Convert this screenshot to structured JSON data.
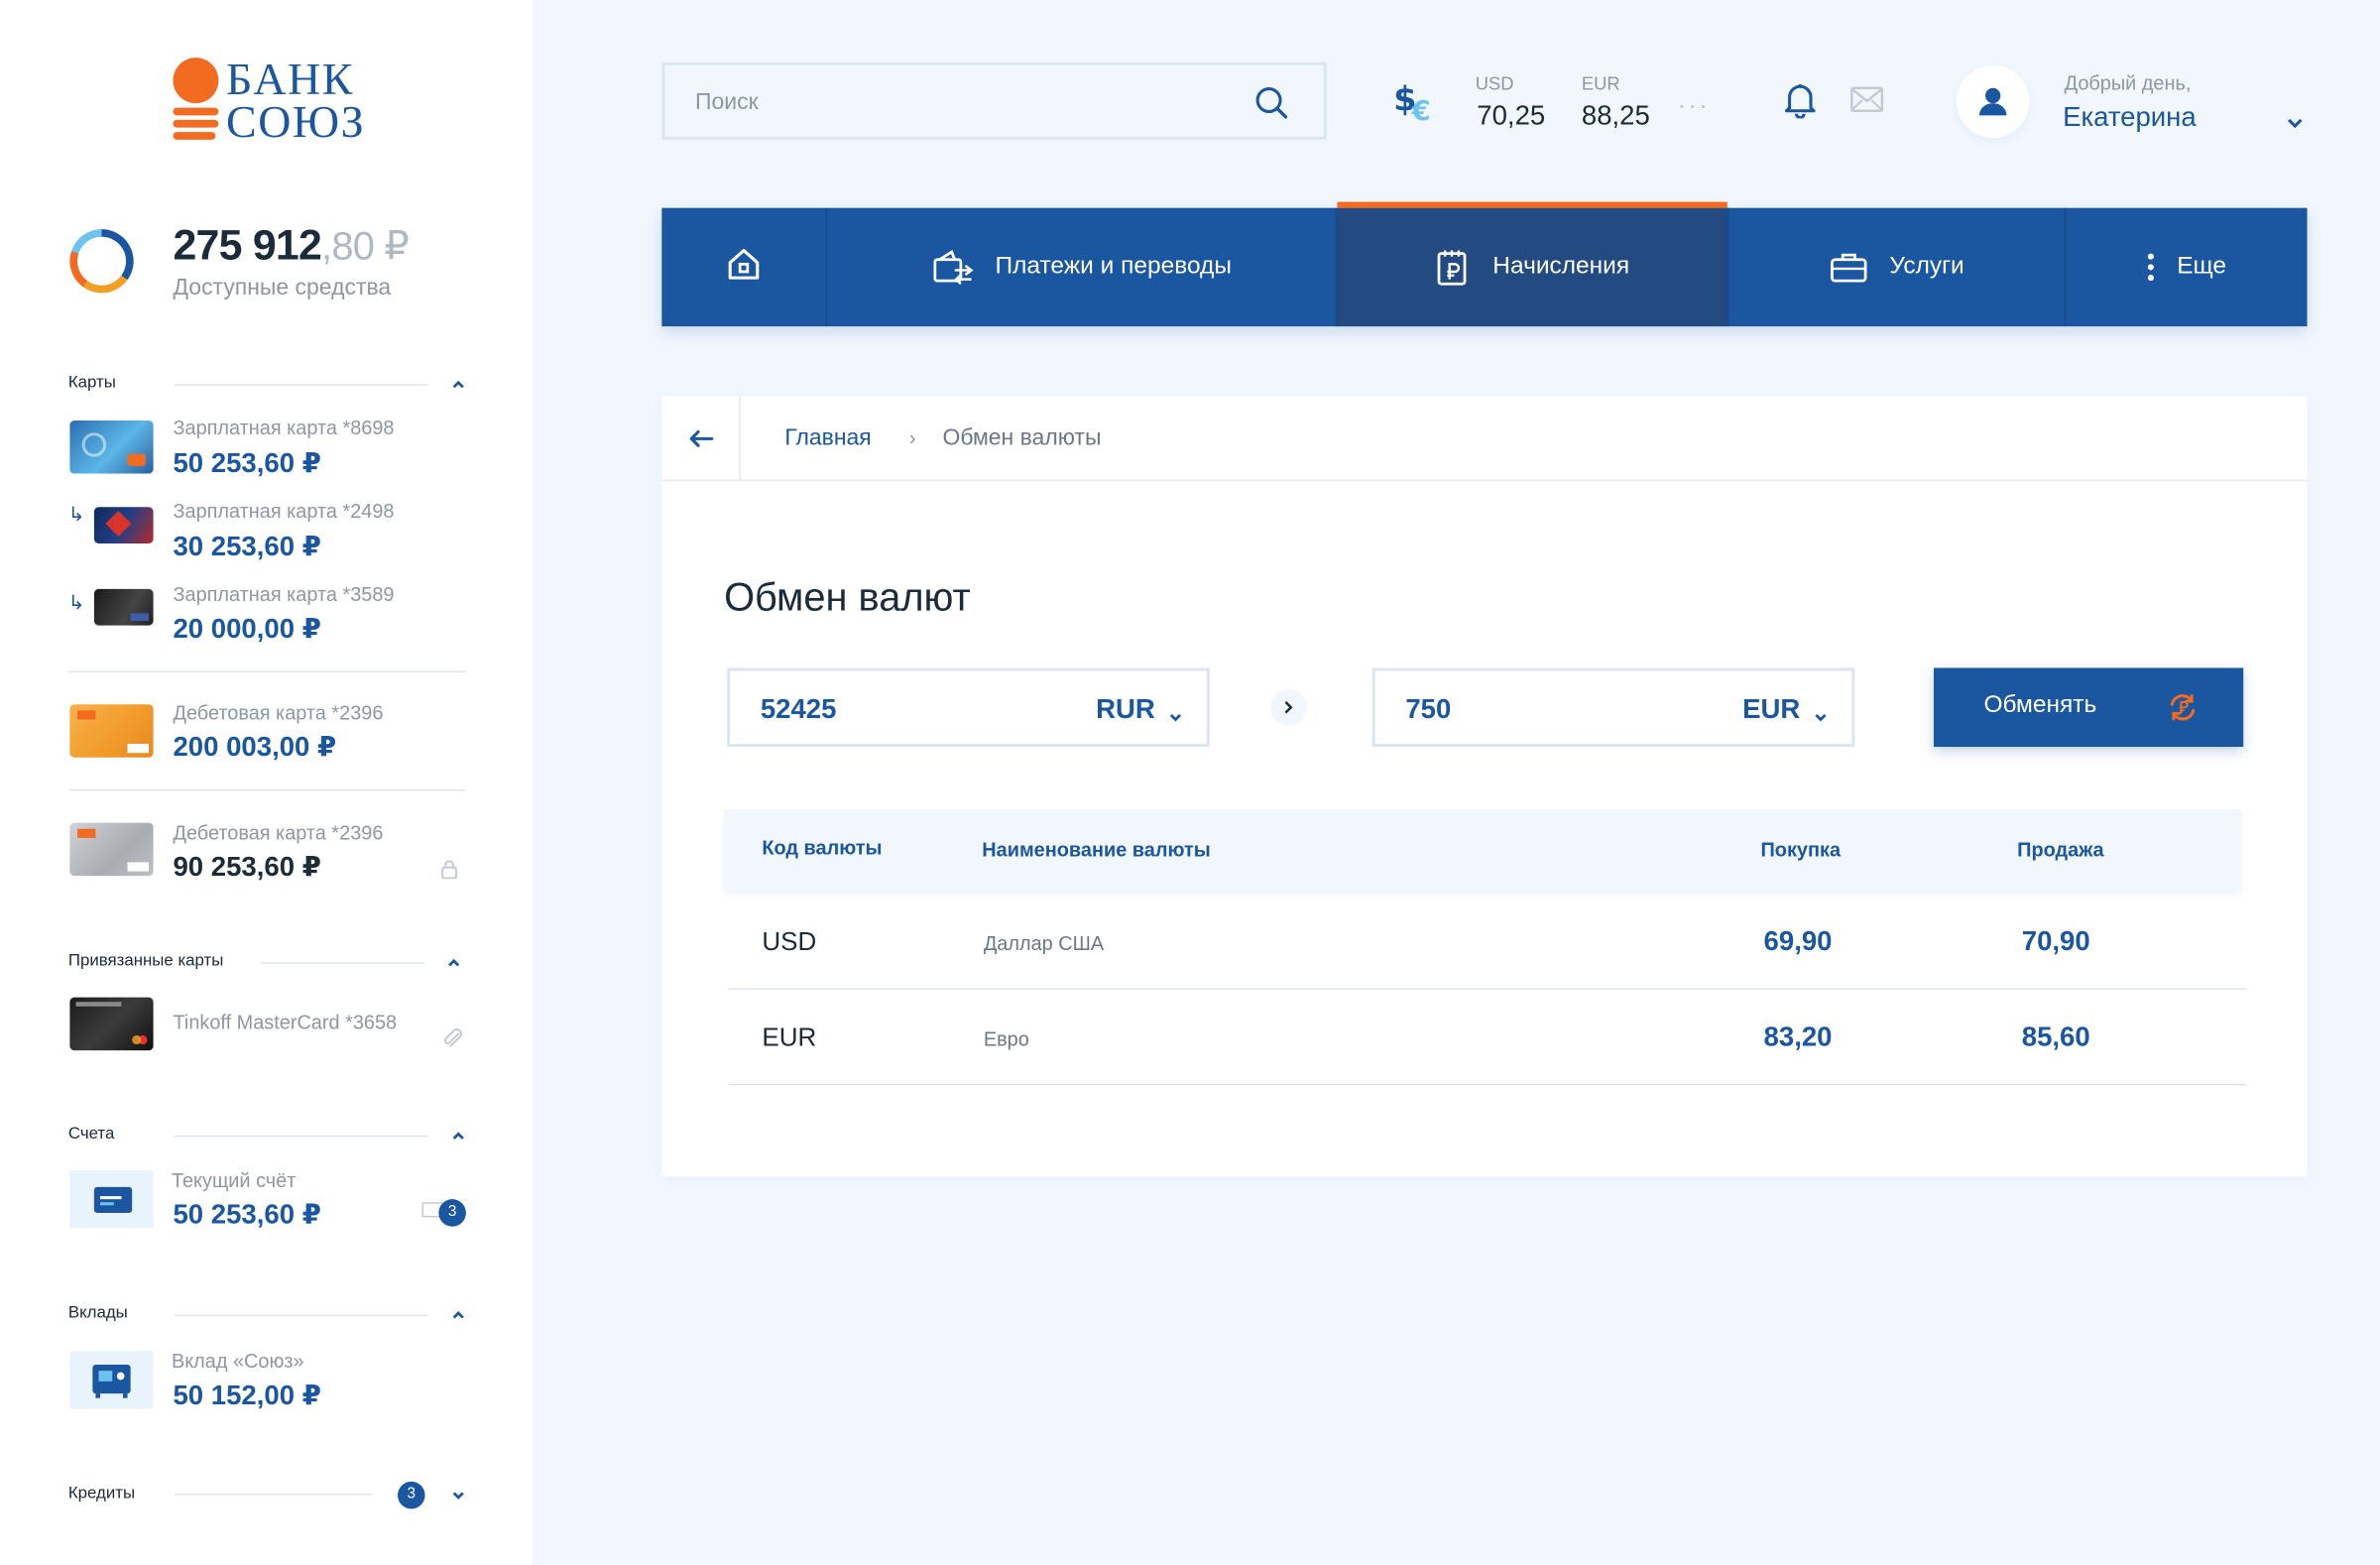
{
  "brand": {
    "line1": "БАНК",
    "line2": "СОЮЗ"
  },
  "balance": {
    "integer": "275 912",
    "decimal": ",80 ₽",
    "label": "Доступные средства"
  },
  "sidebar": {
    "cards_title": "Карты",
    "cards": [
      {
        "label": "Зарплатная карта *8698",
        "amount": "50 253,60 ₽"
      },
      {
        "label": "Зарплатная карта *2498",
        "amount": "30 253,60 ₽"
      },
      {
        "label": "Зарплатная карта *3589",
        "amount": "20 000,00 ₽"
      },
      {
        "label": "Дебетовая карта *2396",
        "amount": "200 003,00 ₽"
      },
      {
        "label": "Дебетовая карта *2396",
        "amount": "90 253,60 ₽"
      }
    ],
    "linked_title": "Привязанные карты",
    "linked": [
      {
        "label": "Tinkoff MasterCard *3658"
      }
    ],
    "accounts_title": "Счета",
    "accounts": [
      {
        "label": "Текущий счёт",
        "amount": "50 253,60 ₽",
        "badge": "3"
      }
    ],
    "deposits_title": "Вклады",
    "deposits": [
      {
        "label": "Вклад «Союз»",
        "amount": "50 152,00 ₽"
      }
    ],
    "credits_title": "Кредиты",
    "credits_badge": "3"
  },
  "header": {
    "search_placeholder": "Поиск",
    "rates": [
      {
        "code": "USD",
        "value": "70,25"
      },
      {
        "code": "EUR",
        "value": "88,25"
      }
    ],
    "greeting": "Добрый день,",
    "user_name": "Екатерина"
  },
  "nav": {
    "items": [
      {
        "label": "",
        "icon": "home-icon"
      },
      {
        "label": "Платежи и переводы",
        "icon": "wallet-transfer-icon"
      },
      {
        "label": "Начисления",
        "icon": "ruble-document-icon",
        "active": true
      },
      {
        "label": "Услуги",
        "icon": "briefcase-icon"
      },
      {
        "label": "Еще",
        "icon": "more-vertical-icon"
      }
    ]
  },
  "breadcrumb": {
    "home": "Главная",
    "current": "Обмен валюты"
  },
  "exchange": {
    "title": "Обмен валют",
    "from_amount": "52425",
    "from_currency": "RUR",
    "to_amount": "750",
    "to_currency": "EUR",
    "submit_label": "Обменять"
  },
  "rates_table": {
    "columns": [
      "Код валюты",
      "Наименование валюты",
      "Покупка",
      "Продажа"
    ],
    "rows": [
      {
        "code": "USD",
        "name": "Даллар США",
        "buy": "69,90",
        "sell": "70,90"
      },
      {
        "code": "EUR",
        "name": "Евро",
        "buy": "83,20",
        "sell": "85,60"
      }
    ]
  },
  "colors": {
    "primary": "#1b56a0",
    "accent": "#f26b21",
    "background": "#f1f7fd",
    "nav_active": "#234b81"
  }
}
